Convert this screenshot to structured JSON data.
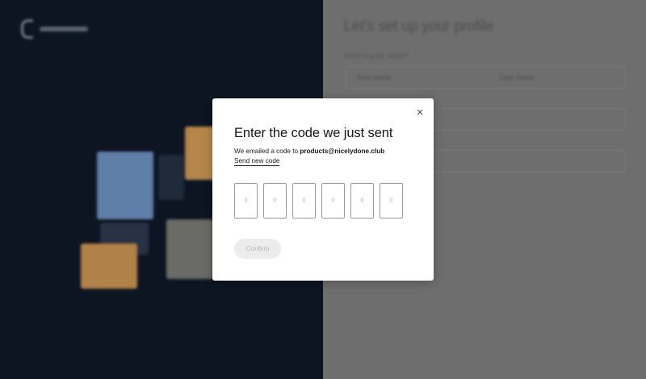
{
  "modal": {
    "title": "Enter the code we just sent",
    "description_prefix": "We emailed a code to ",
    "email": "products@nicelydone.club",
    "resend_label": "Send new code",
    "code_placeholders": [
      "0",
      "0",
      "0",
      "0",
      "0",
      "0"
    ],
    "confirm_label": "Confirm",
    "close_icon": "close-icon"
  },
  "background": {
    "profile_title": "Let's set up your profile",
    "name_label": "What is your name?",
    "first_name_placeholder": "First name",
    "last_name_placeholder": "Last name"
  },
  "colors": {
    "left_pane": "#0d1522",
    "right_pane": "#6e6e6e",
    "modal_bg": "#ffffff",
    "confirm_disabled_bg": "#ececec"
  }
}
